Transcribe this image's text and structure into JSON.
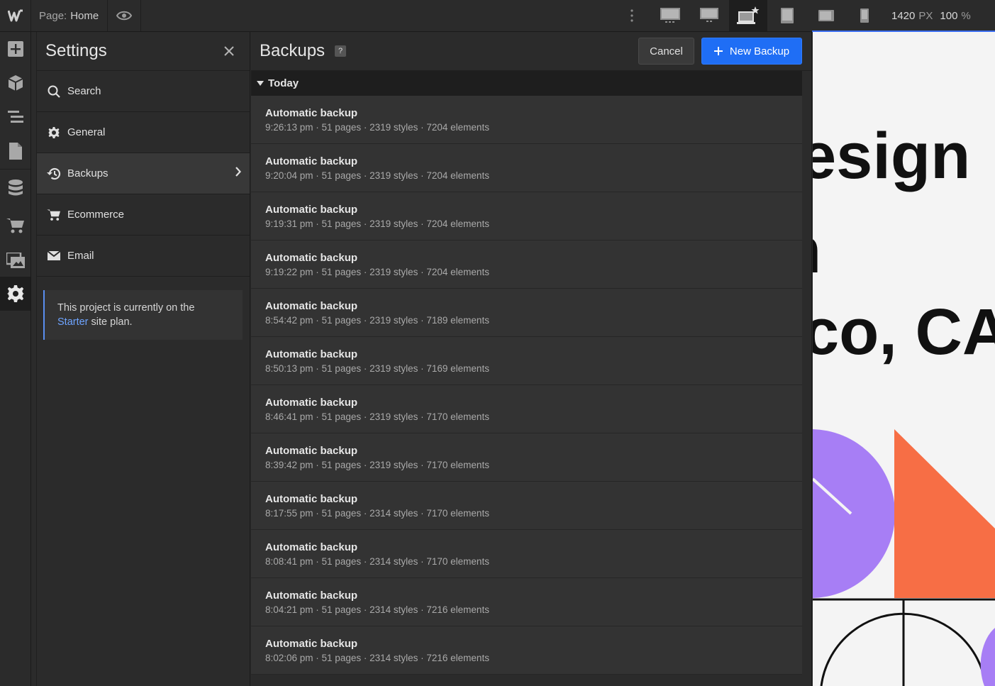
{
  "topbar": {
    "logo": "W",
    "page_prefix": "Page:",
    "page_name": "Home",
    "width_value": "1420",
    "width_unit": "PX",
    "zoom_value": "100",
    "zoom_unit": "%"
  },
  "settings": {
    "title": "Settings",
    "menu": [
      {
        "label": "Search",
        "icon": "search-icon"
      },
      {
        "label": "General",
        "icon": "gear-icon"
      },
      {
        "label": "Backups",
        "icon": "history-icon"
      },
      {
        "label": "Ecommerce",
        "icon": "cart-icon"
      },
      {
        "label": "Email",
        "icon": "mail-icon"
      }
    ],
    "plan_note": {
      "prefix": "This project is currently on the",
      "plan_link": "Starter",
      "suffix": "site plan."
    }
  },
  "backups": {
    "title": "Backups",
    "help": "?",
    "cancel_label": "Cancel",
    "new_label": "New Backup",
    "group_label": "Today",
    "items": [
      {
        "title": "Automatic backup",
        "meta": "9:26:13 pm · 51 pages · 2319 styles · 7204 elements"
      },
      {
        "title": "Automatic backup",
        "meta": "9:20:04 pm · 51 pages · 2319 styles · 7204 elements"
      },
      {
        "title": "Automatic backup",
        "meta": "9:19:31 pm · 51 pages · 2319 styles · 7204 elements"
      },
      {
        "title": "Automatic backup",
        "meta": "9:19:22 pm · 51 pages · 2319 styles · 7204 elements"
      },
      {
        "title": "Automatic backup",
        "meta": "8:54:42 pm · 51 pages · 2319 styles · 7189 elements"
      },
      {
        "title": "Automatic backup",
        "meta": "8:50:13 pm · 51 pages · 2319 styles · 7169 elements"
      },
      {
        "title": "Automatic backup",
        "meta": "8:46:41 pm · 51 pages · 2319 styles · 7170 elements"
      },
      {
        "title": "Automatic backup",
        "meta": "8:39:42 pm · 51 pages · 2319 styles · 7170 elements"
      },
      {
        "title": "Automatic backup",
        "meta": "8:17:55 pm · 51 pages · 2314 styles · 7170 elements"
      },
      {
        "title": "Automatic backup",
        "meta": "8:08:41 pm · 51 pages · 2314 styles · 7170 elements"
      },
      {
        "title": "Automatic backup",
        "meta": "8:04:21 pm · 51 pages · 2314 styles · 7216 elements"
      },
      {
        "title": "Automatic backup",
        "meta": "8:02:06 pm · 51 pages · 2314 styles · 7216 elements"
      }
    ]
  },
  "canvas": {
    "text_line_1": "esign",
    "text_line_2": "n",
    "text_line_3": "co, CA"
  },
  "colors": {
    "accent": "#1f6ef5",
    "purple_shape": "#a77ef5",
    "orange_shape": "#f76e45"
  }
}
